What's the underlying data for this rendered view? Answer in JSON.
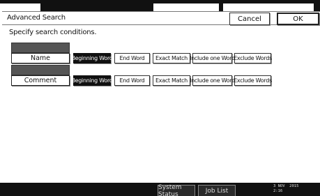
{
  "header": {
    "title": "Advanced Search",
    "cancel_label": "Cancel",
    "ok_label": "OK"
  },
  "subtitle": "Specify search conditions.",
  "rows": [
    {
      "field_label": "Name",
      "options": [
        "Beginning Word",
        "End Word",
        "Exact Match",
        "Include one Word",
        "Exclude Words"
      ],
      "selected": "Beginning Word"
    },
    {
      "field_label": "Comment",
      "options": [
        "Beginning Word",
        "End Word",
        "Exact Match",
        "Include one Word",
        "Exclude Words"
      ],
      "selected": "Beginning Word"
    }
  ],
  "footer": {
    "system_status_label": "System Status",
    "job_list_label": "Job List",
    "date": "3 NOV  2015",
    "time": "2:16"
  }
}
